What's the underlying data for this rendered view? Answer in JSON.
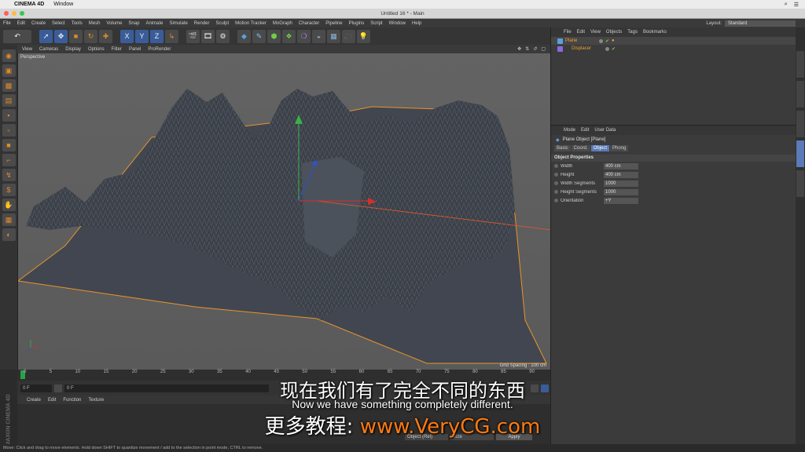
{
  "mac_menu": {
    "app": "CINEMA 4D",
    "items": [
      "Window"
    ]
  },
  "window": {
    "title": "Untitled 16 * - Main"
  },
  "main_menu": [
    "File",
    "Edit",
    "Create",
    "Select",
    "Tools",
    "Mesh",
    "Volume",
    "Snap",
    "Animate",
    "Simulate",
    "Render",
    "Sculpt",
    "Motion Tracker",
    "MoGraph",
    "Character",
    "Pipeline",
    "Plugins",
    "Script",
    "Window",
    "Help"
  ],
  "layout": {
    "label": "Layout:",
    "value": "Standard"
  },
  "toolbar": {
    "axis_x": "X",
    "axis_y": "Y",
    "axis_z": "Z"
  },
  "viewport": {
    "menu": [
      "View",
      "Cameras",
      "Display",
      "Options",
      "Filter",
      "Panel",
      "ProRender"
    ],
    "label": "Perspective",
    "grid_spacing": "Grid Spacing : 100 cm"
  },
  "timeline": {
    "ticks": [
      "0",
      "5",
      "10",
      "15",
      "20",
      "25",
      "30",
      "35",
      "40",
      "45",
      "50",
      "55",
      "60",
      "65",
      "70",
      "75",
      "80",
      "85",
      "90"
    ]
  },
  "transport": {
    "frame_start": "0 F",
    "frame_current": "0 F"
  },
  "material_manager": {
    "menu": [
      "Create",
      "Edit",
      "Function",
      "Texture"
    ]
  },
  "coord_bottom": {
    "mode": "Object (Rel)",
    "size": "Size",
    "apply": "Apply"
  },
  "status_bar": "Move: Click and drag to move elements. Hold down SHIFT to quantize movement / add to the selection in point mode, CTRL to remove.",
  "object_manager": {
    "menu": [
      "File",
      "Edit",
      "View",
      "Objects",
      "Tags",
      "Bookmarks"
    ],
    "objects": [
      {
        "name": "Plane"
      },
      {
        "name": "Displacer"
      }
    ]
  },
  "attribute_manager": {
    "menu": [
      "Mode",
      "Edit",
      "User Data"
    ],
    "title": "Plane Object [Plane]",
    "tabs": [
      "Basic",
      "Coord.",
      "Object",
      "Phong"
    ],
    "active_tab": "Object",
    "section": "Object Properties",
    "properties": [
      {
        "label": "Width",
        "value": "400 cm"
      },
      {
        "label": "Height",
        "value": "400 cm"
      },
      {
        "label": "Width Segments",
        "value": "1000"
      },
      {
        "label": "Height Segments",
        "value": "1000"
      },
      {
        "label": "Orientation",
        "value": "+Y"
      }
    ]
  },
  "subtitles": {
    "chinese": "现在我们有了完全不同的东西",
    "english": "Now we have something completely different.",
    "ad_prefix": "更多教程:",
    "ad_url": "www.VeryCG.com"
  },
  "colors": {
    "accent": "#5a7ab8",
    "selection": "#f0a030",
    "mesh": "#3c4048",
    "viewport": "#606060"
  }
}
